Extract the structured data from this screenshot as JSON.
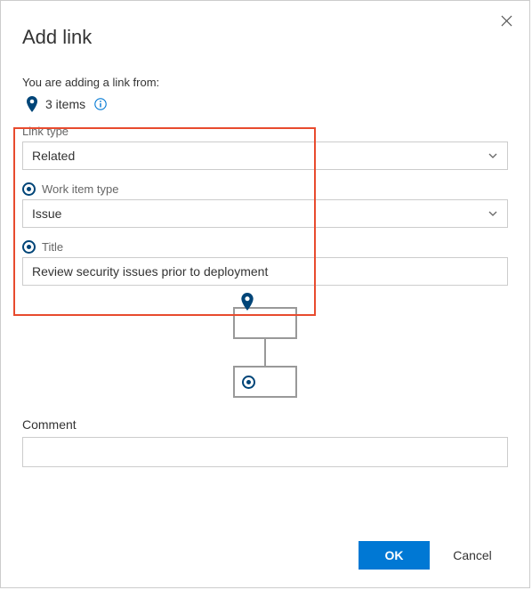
{
  "dialog": {
    "title": "Add link",
    "subtitle": "You are adding a link from:",
    "items_count": "3 items"
  },
  "form": {
    "link_type_label": "Link type",
    "link_type_value": "Related",
    "work_item_type_label": "Work item type",
    "work_item_type_value": "Issue",
    "title_label": "Title",
    "title_value": "Review security issues prior to deployment",
    "comment_label": "Comment",
    "comment_value": ""
  },
  "footer": {
    "ok": "OK",
    "cancel": "Cancel"
  },
  "colors": {
    "accent": "#0078d4",
    "ring": "#004578",
    "highlight": "#e84b2e"
  }
}
